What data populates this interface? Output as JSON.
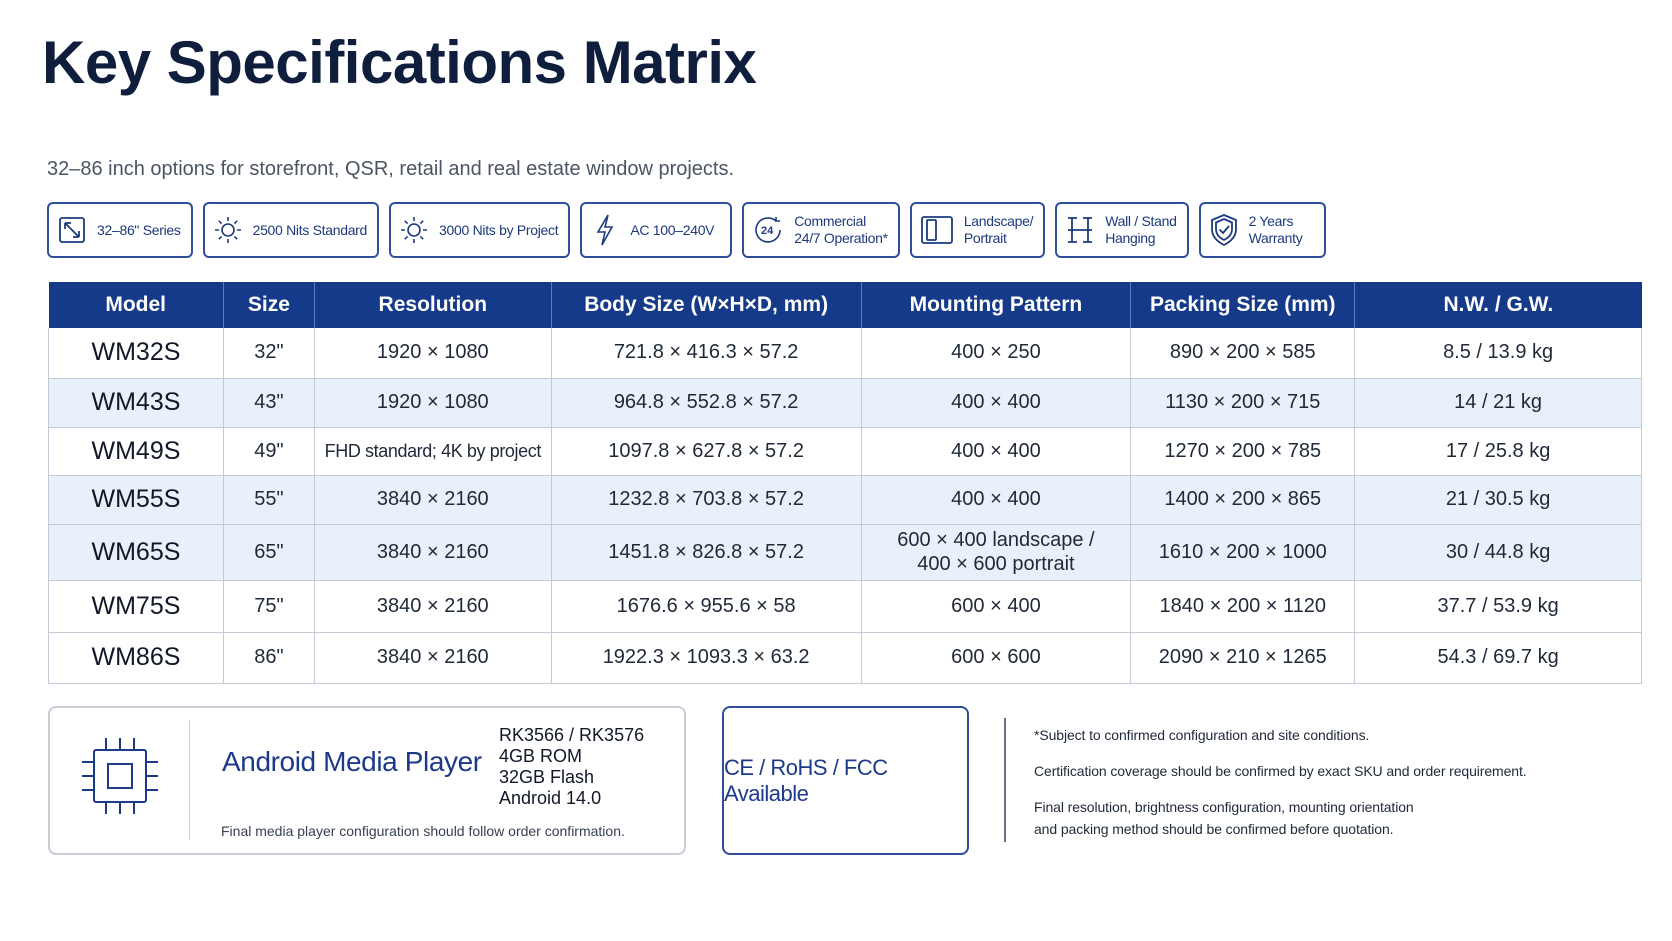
{
  "title": "Key Specifications Matrix",
  "subtitle": "32–86 inch options for storefront, QSR, retail and real estate window projects.",
  "accent_color": "#163a8a",
  "badges": [
    {
      "icon": "resize-arrows-icon",
      "label": "32–86\" Series"
    },
    {
      "icon": "sun-icon",
      "label": "2500 Nits Standard"
    },
    {
      "icon": "sun-icon",
      "label": "3000 Nits by Project"
    },
    {
      "icon": "lightning-icon",
      "label": "AC 100–240V"
    },
    {
      "icon": "clock-24-icon",
      "label": "Commercial\n24/7 Operation*"
    },
    {
      "icon": "portrait-landscape-icon",
      "label": "Landscape/\nPortrait"
    },
    {
      "icon": "wall-stand-icon",
      "label": "Wall / Stand\nHanging"
    },
    {
      "icon": "shield-check-icon",
      "label": "2 Years\nWarranty"
    }
  ],
  "table": {
    "headers": [
      "Model",
      "Size",
      "Resolution",
      "Body Size (W×H×D, mm)",
      "Mounting Pattern",
      "Packing Size (mm)",
      "N.W. / G.W."
    ],
    "rows": [
      {
        "model": "WM32S",
        "size": "32\"",
        "resolution": "1920 × 1080",
        "body": "721.8 × 416.3 × 57.2",
        "mount": "400 × 250",
        "mount2": "",
        "packing": "890 × 200 × 585",
        "weight": "8.5 / 13.9 kg"
      },
      {
        "model": "WM43S",
        "size": "43\"",
        "resolution": "1920 × 1080",
        "body": "964.8 × 552.8 × 57.2",
        "mount": "400 × 400",
        "mount2": "",
        "packing": "1130 × 200 × 715",
        "weight": "14 / 21 kg"
      },
      {
        "model": "WM49S",
        "size": "49\"",
        "resolution": "FHD standard; 4K by project",
        "body": "1097.8 × 627.8 × 57.2",
        "mount": "400 × 400",
        "mount2": "",
        "packing": "1270 × 200 × 785",
        "weight": "17 / 25.8 kg"
      },
      {
        "model": "WM55S",
        "size": "55\"",
        "resolution": "3840 × 2160",
        "body": "1232.8 × 703.8 × 57.2",
        "mount": "400 × 400",
        "mount2": "",
        "packing": "1400 × 200 × 865",
        "weight": "21 / 30.5 kg"
      },
      {
        "model": "WM65S",
        "size": "65\"",
        "resolution": "3840 × 2160",
        "body": "1451.8 × 826.8 × 57.2",
        "mount": "600 × 400 landscape /",
        "mount2": "400 × 600 portrait",
        "packing": "1610 × 200 × 1000",
        "weight": "30 / 44.8 kg"
      },
      {
        "model": "WM75S",
        "size": "75\"",
        "resolution": "3840 × 2160",
        "body": "1676.6 × 955.6 × 58",
        "mount": "600 × 400",
        "mount2": "",
        "packing": "1840 × 200 × 1120",
        "weight": "37.7 / 53.9 kg"
      },
      {
        "model": "WM86S",
        "size": "86\"",
        "resolution": "3840 × 2160",
        "body": "1922.3 × 1093.3 × 63.2",
        "mount": "600 × 600",
        "mount2": "",
        "packing": "2090 × 210 × 1265",
        "weight": "54.3 / 69.7 kg"
      }
    ]
  },
  "player": {
    "title": "Android Media Player",
    "specs": [
      "RK3566 / RK3576",
      "4GB ROM",
      "32GB Flash",
      "Android 14.0"
    ],
    "note": "Final media player configuration should follow order confirmation."
  },
  "cert": "CE / RoHS / FCC Available",
  "notes": [
    "*Subject to confirmed configuration and site conditions.",
    "Certification coverage should be confirmed by exact SKU and order requirement.",
    "Final resolution, brightness configuration, mounting orientation\nand packing method should be confirmed before quotation."
  ]
}
